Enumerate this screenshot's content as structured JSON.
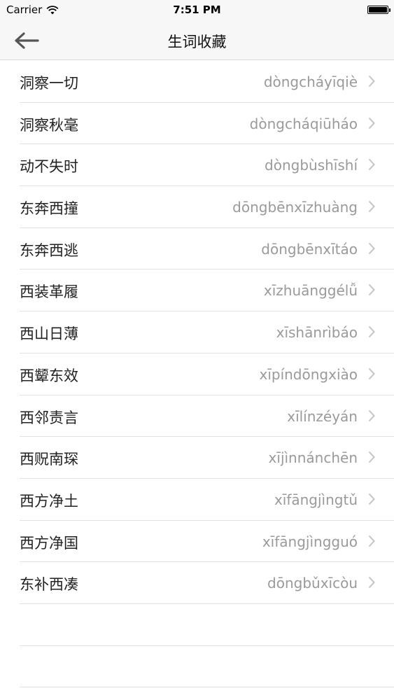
{
  "status_bar": {
    "carrier": "Carrier",
    "time": "7:51 PM"
  },
  "nav": {
    "title": "生词收藏",
    "back_icon": "arrow-left-icon"
  },
  "words": [
    {
      "word": "洞察一切",
      "pinyin": "dòngcháyīqiè"
    },
    {
      "word": "洞察秋毫",
      "pinyin": "dòngcháqiūháo"
    },
    {
      "word": "动不失时",
      "pinyin": "dòngbùshīshí"
    },
    {
      "word": "东奔西撞",
      "pinyin": "dōngbēnxīzhuàng"
    },
    {
      "word": "东奔西逃",
      "pinyin": "dōngbēnxītáo"
    },
    {
      "word": "西装革履",
      "pinyin": "xīzhuānggélǚ"
    },
    {
      "word": "西山日薄",
      "pinyin": "xīshānrìbáo"
    },
    {
      "word": "西颦东效",
      "pinyin": "xīpíndōngxiào"
    },
    {
      "word": "西邻责言",
      "pinyin": "xīlínzéyán"
    },
    {
      "word": "西贶南琛",
      "pinyin": "xījìnnánchēn"
    },
    {
      "word": "西方净土",
      "pinyin": "xīfāngjìngtǔ"
    },
    {
      "word": "西方净国",
      "pinyin": "xīfāngjìngguó"
    },
    {
      "word": "东补西凑",
      "pinyin": "dōngbǔxīcòu"
    }
  ]
}
